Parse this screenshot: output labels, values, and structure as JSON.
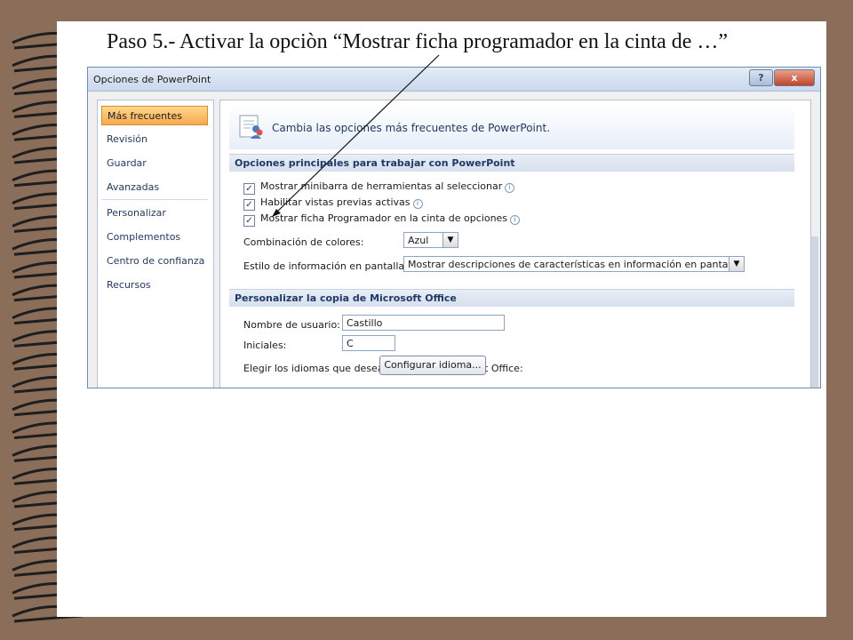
{
  "slide": {
    "title": "Paso 5.-  Activar la opciòn “Mostrar ficha programador en la cinta de …”"
  },
  "dialog": {
    "title": "Opciones de PowerPoint",
    "help_icon": "question-mark-icon",
    "close_icon": "close-x-icon",
    "help_label": "?",
    "close_label": "x"
  },
  "nav": {
    "items": [
      {
        "label": "Más frecuentes",
        "active": true
      },
      {
        "label": "Revisión"
      },
      {
        "label": "Guardar"
      },
      {
        "label": "Avanzadas"
      },
      {
        "label": "Personalizar"
      },
      {
        "label": "Complementos"
      },
      {
        "label": "Centro de confianza"
      },
      {
        "label": "Recursos"
      }
    ]
  },
  "content": {
    "banner_text": "Cambia las opciones más frecuentes de PowerPoint.",
    "section1": {
      "heading": "Opciones principales para trabajar con PowerPoint",
      "checkboxes": [
        {
          "label": "Mostrar minibarra de herramientas al seleccionar",
          "checked": true
        },
        {
          "label": "Habilitar vistas previas activas",
          "checked": true
        },
        {
          "label": "Mostrar ficha Programador en la cinta de opciones",
          "checked": true
        }
      ],
      "color_label": "Combinación de colores:",
      "color_value": "Azul",
      "tooltip_label": "Estilo de información en pantalla:",
      "tooltip_value": "Mostrar descripciones de características en información en pantalla"
    },
    "section2": {
      "heading": "Personalizar la copia de Microsoft Office",
      "username_label": "Nombre de usuario:",
      "username_value": "Castillo",
      "initials_label": "Iniciales:",
      "initials_value": "C",
      "language_label": "Elegir los idiomas que desea utilizar con Microsoft Office:",
      "language_button": "Configurar idioma..."
    }
  },
  "colors": {
    "background": "#8b6e5a",
    "accent_orange": "#f6a84e",
    "nav_text": "#1f3a66"
  }
}
